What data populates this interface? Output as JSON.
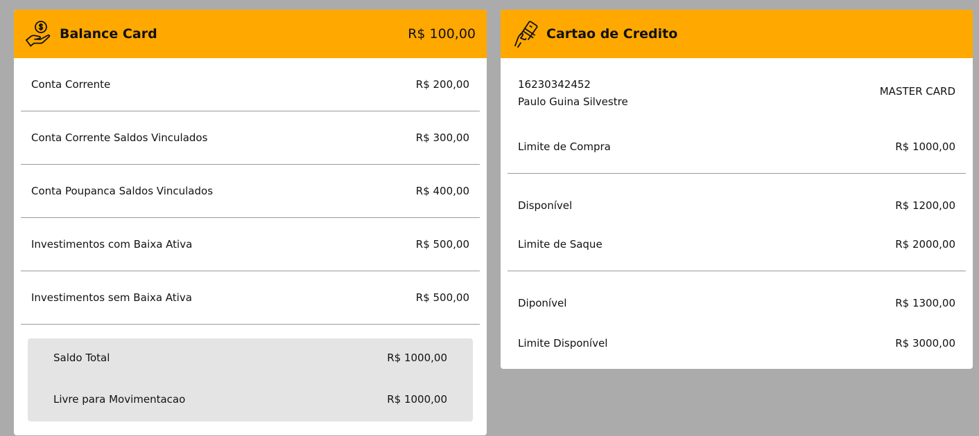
{
  "balance_card": {
    "title": "Balance Card",
    "total": "R$ 100,00",
    "icon": "money-hand-icon",
    "rows": [
      {
        "label": "Conta Corrente",
        "value": "R$ 200,00"
      },
      {
        "label": "Conta Corrente Saldos Vinculados",
        "value": "R$ 300,00"
      },
      {
        "label": "Conta Poupanca Saldos Vinculados",
        "value": "R$ 400,00"
      },
      {
        "label": "Investimentos com Baixa Ativa",
        "value": "R$ 500,00"
      },
      {
        "label": "Investimentos sem Baixa Ativa",
        "value": "R$ 500,00"
      }
    ],
    "summary": [
      {
        "label": "Saldo Total",
        "value": "R$ 1000,00"
      },
      {
        "label": "Livre para Movimentacao",
        "value": "R$ 1000,00"
      }
    ]
  },
  "credit_card": {
    "title": "Cartao de Credito",
    "icon": "credit-card-hand-icon",
    "number": "16230342452",
    "holder": "Paulo Guina Silvestre",
    "brand": "MASTER CARD",
    "rows": [
      {
        "label": "Limite de Compra",
        "value": "R$ 1000,00"
      },
      {
        "label": "Disponível",
        "value": "R$ 1200,00"
      },
      {
        "label": "Limite de Saque",
        "value": "R$ 2000,00"
      },
      {
        "label": "Diponível",
        "value": "R$ 1300,00"
      },
      {
        "label": "Limite Disponível",
        "value": "R$ 3000,00"
      }
    ]
  },
  "colors": {
    "header": "#ffa800",
    "background": "#ababab",
    "summary_bg": "#e4e4e4"
  }
}
